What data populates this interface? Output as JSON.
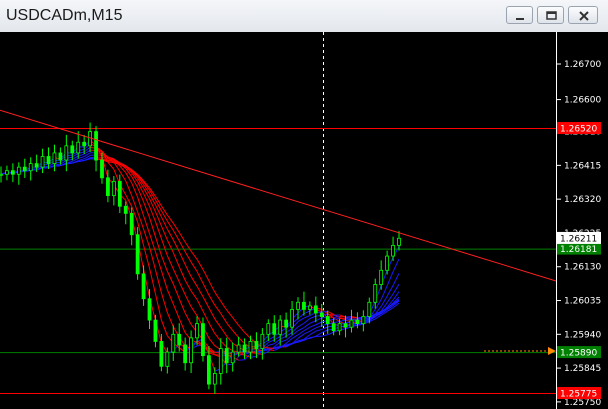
{
  "window": {
    "title": "USDCADm,M15",
    "buttons": [
      "minimize-icon",
      "restore-icon",
      "close-icon"
    ]
  },
  "colors": {
    "background": "#000000",
    "bull_candle": "#00ff00",
    "trendline": "#ff2020",
    "level_red": "#ff0000",
    "level_green": "#008000",
    "ribbon_down": "#ff0000",
    "ribbon_up": "#1a1aff",
    "axis_text": "#ffffff"
  },
  "price_axis": {
    "ticks": [
      "1.26700",
      "1.26600",
      "1.26415",
      "1.26320",
      "1.26130",
      "1.26035",
      "1.25940",
      "1.25845",
      "1.25750"
    ],
    "tick_values": [
      1.267,
      1.266,
      1.26415,
      1.2632,
      1.2613,
      1.26035,
      1.2594,
      1.25845,
      1.2575
    ],
    "overlapping_ticks": [
      {
        "text": "1.26510",
        "value": 1.2651
      },
      {
        "text": "1.26225",
        "value": 1.26225
      }
    ],
    "min": 1.2573,
    "max": 1.2679
  },
  "levels": [
    {
      "label": "1.26520",
      "value": 1.2652,
      "color": "#ff0000",
      "fill": "#ff0000"
    },
    {
      "label": "1.26181",
      "value": 1.26181,
      "color": "#008000",
      "fill": "#008000"
    },
    {
      "label": "1.25890",
      "value": 1.2589,
      "color": "#008000",
      "fill": "#008000"
    },
    {
      "label": "1.25775",
      "value": 1.25775,
      "color": "#ff0000",
      "fill": "#ff0000"
    }
  ],
  "current_price": {
    "label": "1.26211",
    "value": 1.26211
  },
  "trendline": {
    "start": [
      0,
      1.2657
    ],
    "end": [
      1,
      1.2609
    ]
  },
  "chart_data": {
    "type": "line",
    "title": "USDCADm,M15",
    "xlabel": "",
    "ylabel": "",
    "ylim": [
      1.2573,
      1.2679
    ],
    "grid": false,
    "series": [
      {
        "values": [
          1.2639,
          1.264,
          1.2639,
          1.2641,
          1.264,
          1.2642,
          1.2641,
          1.2644,
          1.2642,
          1.2645,
          1.2643,
          1.2647,
          1.2645,
          1.2648,
          1.2647,
          1.2651,
          1.2643,
          1.2638,
          1.2633,
          1.2637,
          1.263,
          1.2628,
          1.2622,
          1.2611,
          1.2604,
          1.2598,
          1.2592,
          1.2585,
          1.2589,
          1.2594,
          1.2591,
          1.2586,
          1.2593,
          1.2597,
          1.2588,
          1.258,
          1.2583,
          1.259,
          1.2586,
          1.2589,
          1.2591,
          1.2589,
          1.2592,
          1.259,
          1.2594,
          1.2597,
          1.2594,
          1.2598,
          1.2596,
          1.2601,
          1.2603,
          1.2601,
          1.2602,
          1.26,
          1.2599,
          1.2597,
          1.2595,
          1.2597,
          1.2596,
          1.2598,
          1.2597,
          1.2599,
          1.2603,
          1.2608,
          1.2612,
          1.2616,
          1.2619,
          1.2621
        ]
      }
    ]
  }
}
